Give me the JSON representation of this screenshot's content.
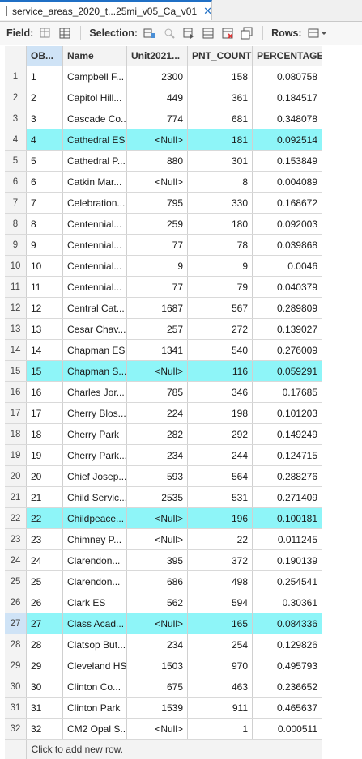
{
  "tab": {
    "title": "service_areas_2020_t...25mi_v05_Ca_v01",
    "close_glyph": "✕"
  },
  "toolbar": {
    "field_label": "Field:",
    "selection_label": "Selection:",
    "rows_label": "Rows:"
  },
  "table": {
    "columns": [
      "OB...",
      "Name",
      "Unit2021...",
      "PNT_COUNT",
      "PERCENTAGE"
    ],
    "rows": [
      {
        "rn": "1",
        "ob": "1",
        "name": "Campbell F...",
        "unit": "2300",
        "pnt": "158",
        "pct": "0.080758"
      },
      {
        "rn": "2",
        "ob": "2",
        "name": "Capitol Hill...",
        "unit": "449",
        "pnt": "361",
        "pct": "0.184517"
      },
      {
        "rn": "3",
        "ob": "3",
        "name": "Cascade Co...",
        "unit": "774",
        "pnt": "681",
        "pct": "0.348078"
      },
      {
        "rn": "4",
        "ob": "4",
        "name": "Cathedral ES",
        "unit": "<Null>",
        "pnt": "181",
        "pct": "0.092514"
      },
      {
        "rn": "5",
        "ob": "5",
        "name": "Cathedral P...",
        "unit": "880",
        "pnt": "301",
        "pct": "0.153849"
      },
      {
        "rn": "6",
        "ob": "6",
        "name": "Catkin Mar...",
        "unit": "<Null>",
        "pnt": "8",
        "pct": "0.004089"
      },
      {
        "rn": "7",
        "ob": "7",
        "name": "Celebration...",
        "unit": "795",
        "pnt": "330",
        "pct": "0.168672"
      },
      {
        "rn": "8",
        "ob": "8",
        "name": "Centennial...",
        "unit": "259",
        "pnt": "180",
        "pct": "0.092003"
      },
      {
        "rn": "9",
        "ob": "9",
        "name": "Centennial...",
        "unit": "77",
        "pnt": "78",
        "pct": "0.039868"
      },
      {
        "rn": "10",
        "ob": "10",
        "name": "Centennial...",
        "unit": "9",
        "pnt": "9",
        "pct": "0.0046"
      },
      {
        "rn": "11",
        "ob": "11",
        "name": "Centennial...",
        "unit": "77",
        "pnt": "79",
        "pct": "0.040379"
      },
      {
        "rn": "12",
        "ob": "12",
        "name": "Central Cat...",
        "unit": "1687",
        "pnt": "567",
        "pct": "0.289809"
      },
      {
        "rn": "13",
        "ob": "13",
        "name": "Cesar Chav...",
        "unit": "257",
        "pnt": "272",
        "pct": "0.139027"
      },
      {
        "rn": "14",
        "ob": "14",
        "name": "Chapman ES",
        "unit": "1341",
        "pnt": "540",
        "pct": "0.276009"
      },
      {
        "rn": "15",
        "ob": "15",
        "name": "Chapman S...",
        "unit": "<Null>",
        "pnt": "116",
        "pct": "0.059291"
      },
      {
        "rn": "16",
        "ob": "16",
        "name": "Charles Jor...",
        "unit": "785",
        "pnt": "346",
        "pct": "0.17685"
      },
      {
        "rn": "17",
        "ob": "17",
        "name": "Cherry Blos...",
        "unit": "224",
        "pnt": "198",
        "pct": "0.101203"
      },
      {
        "rn": "18",
        "ob": "18",
        "name": "Cherry Park",
        "unit": "282",
        "pnt": "292",
        "pct": "0.149249"
      },
      {
        "rn": "19",
        "ob": "19",
        "name": "Cherry Park...",
        "unit": "234",
        "pnt": "244",
        "pct": "0.124715"
      },
      {
        "rn": "20",
        "ob": "20",
        "name": "Chief Josep...",
        "unit": "593",
        "pnt": "564",
        "pct": "0.288276"
      },
      {
        "rn": "21",
        "ob": "21",
        "name": "Child Servic...",
        "unit": "2535",
        "pnt": "531",
        "pct": "0.271409"
      },
      {
        "rn": "22",
        "ob": "22",
        "name": "Childpeace...",
        "unit": "<Null>",
        "pnt": "196",
        "pct": "0.100181"
      },
      {
        "rn": "23",
        "ob": "23",
        "name": "Chimney P...",
        "unit": "<Null>",
        "pnt": "22",
        "pct": "0.011245"
      },
      {
        "rn": "24",
        "ob": "24",
        "name": "Clarendon...",
        "unit": "395",
        "pnt": "372",
        "pct": "0.190139"
      },
      {
        "rn": "25",
        "ob": "25",
        "name": "Clarendon...",
        "unit": "686",
        "pnt": "498",
        "pct": "0.254541"
      },
      {
        "rn": "26",
        "ob": "26",
        "name": "Clark ES",
        "unit": "562",
        "pnt": "594",
        "pct": "0.30361"
      },
      {
        "rn": "27",
        "ob": "27",
        "name": "Class Acad...",
        "unit": "<Null>",
        "pnt": "165",
        "pct": "0.084336"
      },
      {
        "rn": "28",
        "ob": "28",
        "name": "Clatsop But...",
        "unit": "234",
        "pnt": "254",
        "pct": "0.129826"
      },
      {
        "rn": "29",
        "ob": "29",
        "name": "Cleveland HS",
        "unit": "1503",
        "pnt": "970",
        "pct": "0.495793"
      },
      {
        "rn": "30",
        "ob": "30",
        "name": "Clinton Co...",
        "unit": "675",
        "pnt": "463",
        "pct": "0.236652"
      },
      {
        "rn": "31",
        "ob": "31",
        "name": "Clinton Park",
        "unit": "1539",
        "pnt": "911",
        "pct": "0.465637"
      },
      {
        "rn": "32",
        "ob": "32",
        "name": "CM2 Opal S...",
        "unit": "<Null>",
        "pnt": "1",
        "pct": "0.000511"
      }
    ],
    "highlighted_rows": [
      4,
      15,
      22,
      27
    ],
    "selected_row": 27,
    "add_row_text": "Click to add new row.",
    "highlight_color": "#8ef5f8"
  }
}
